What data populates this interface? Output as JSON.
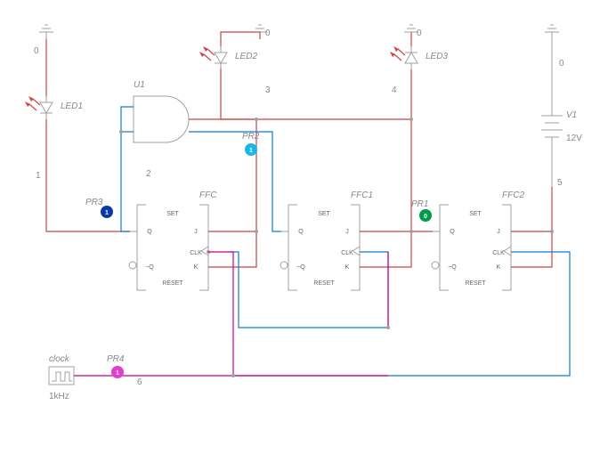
{
  "chart_data": {
    "type": "schematic",
    "components": [
      {
        "ref": "U1",
        "type": "AND-gate"
      },
      {
        "ref": "FFC",
        "type": "JK-flipflop"
      },
      {
        "ref": "FFC1",
        "type": "JK-flipflop"
      },
      {
        "ref": "FFC2",
        "type": "JK-flipflop"
      },
      {
        "ref": "LED1",
        "type": "LED"
      },
      {
        "ref": "LED2",
        "type": "LED"
      },
      {
        "ref": "LED3",
        "type": "LED"
      },
      {
        "ref": "V1",
        "type": "DC-source",
        "value": "12V"
      },
      {
        "ref": "clock",
        "type": "clock",
        "freq": "1kHz"
      }
    ],
    "probes": [
      {
        "ref": "PR1",
        "value": "0",
        "color": "#009a4a"
      },
      {
        "ref": "PR2",
        "value": "1",
        "color": "#15b8e8"
      },
      {
        "ref": "PR3",
        "value": "1",
        "color": "#0b3aa8"
      },
      {
        "ref": "PR4",
        "value": "1",
        "color": "#e43bd1"
      }
    ],
    "nets": [
      0,
      1,
      2,
      3,
      4,
      5,
      6
    ]
  },
  "labels": {
    "u1": "U1",
    "ffc": "FFC",
    "ffc1": "FFC1",
    "ffc2": "FFC2",
    "led1": "LED1",
    "led2": "LED2",
    "led3": "LED3",
    "v1": "V1",
    "v1_val": "12V",
    "clk": "clock",
    "clk_f": "1kHz",
    "pr1": "PR1",
    "pr2": "PR2",
    "pr3": "PR3",
    "pr4": "PR4",
    "pr1_v": "0",
    "pr2_v": "1",
    "pr3_v": "1",
    "pr4_v": "1",
    "n0": "0",
    "n1": "1",
    "n2": "2",
    "n3": "3",
    "n4": "4",
    "n5": "5",
    "n6": "6",
    "set": "SET",
    "reset": "RESET",
    "q": "Q",
    "nq": "~Q",
    "j": "J",
    "k": "K",
    "clkpin": "CLK"
  }
}
